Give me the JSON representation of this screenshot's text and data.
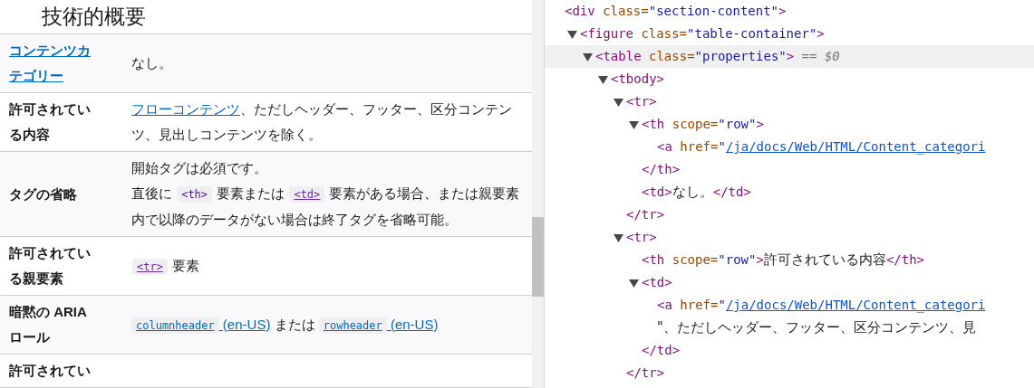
{
  "heading": "技術的概要",
  "rows": [
    {
      "header": {
        "text": "コンテンツカテゴリー",
        "link": true
      },
      "paragraphs": [
        [
          {
            "kind": "text",
            "text": "なし。"
          }
        ]
      ]
    },
    {
      "header": {
        "text": "許可されている内容",
        "link": false
      },
      "paragraphs": [
        [
          {
            "kind": "link",
            "text": "フローコンテンツ"
          },
          {
            "kind": "text",
            "text": "、ただしヘッダー、フッター、区分コンテンツ、見出しコンテンツを除く。"
          }
        ]
      ]
    },
    {
      "header": {
        "text": "タグの省略",
        "link": false
      },
      "paragraphs": [
        [
          {
            "kind": "text",
            "text": "開始タグは必須です。"
          }
        ],
        [
          {
            "kind": "text",
            "text": "直後に "
          },
          {
            "kind": "code",
            "text": "<th>"
          },
          {
            "kind": "text",
            "text": " 要素または "
          },
          {
            "kind": "visited-code-link",
            "text": "<td>"
          },
          {
            "kind": "text",
            "text": " 要素がある場合、または親要素内で以降のデータがない場合は終了タグを省略可能。"
          }
        ]
      ]
    },
    {
      "header": {
        "text": "許可されている親要素",
        "link": false
      },
      "paragraphs": [
        [
          {
            "kind": "visited-code-link",
            "text": "<tr>"
          },
          {
            "kind": "text",
            "text": " 要素"
          }
        ]
      ]
    },
    {
      "header": {
        "text": "暗黙の ARIA ロール",
        "link": false
      },
      "paragraphs": [
        [
          {
            "kind": "code-link",
            "text": "columnheader"
          },
          {
            "kind": "link",
            "text": " (en-US)"
          },
          {
            "kind": "text",
            "text": " または "
          },
          {
            "kind": "code-link",
            "text": "rowheader"
          },
          {
            "kind": "link",
            "text": " (en-US)"
          }
        ]
      ]
    },
    {
      "header": {
        "text": "許可されてい",
        "link": false
      }
    }
  ],
  "dom_tree": [
    {
      "kind": "element",
      "start": "<div",
      "attributes": [
        {
          "name": " class=",
          "value": "\"section-content\""
        }
      ],
      "end": ">",
      "children": [
        {
          "kind": "element",
          "start": "<figure",
          "attributes": [
            {
              "name": " class=",
              "value": "\"table-container\""
            }
          ],
          "end": ">",
          "expanded": true,
          "children": [
            {
              "kind": "element",
              "start": "<table",
              "attributes": [
                {
                  "name": " class=",
                  "value": "\"properties\""
                }
              ],
              "end": ">",
              "expanded": true,
              "selected": true,
              "marker": " == $0",
              "children": [
                {
                  "kind": "element",
                  "start": "<tbody",
                  "end": ">",
                  "expanded": true,
                  "children": [
                    {
                      "kind": "element",
                      "start": "<tr",
                      "end": ">",
                      "expanded": true,
                      "close": "</tr>",
                      "children": [
                        {
                          "kind": "element",
                          "start": "<th",
                          "attributes": [
                            {
                              "name": " scope=",
                              "value": "\"row\""
                            }
                          ],
                          "end": ">",
                          "expanded": true,
                          "close": "</th>",
                          "children": [
                            {
                              "kind": "element",
                              "start": "<a",
                              "attributes": [
                                {
                                  "name": " href=",
                                  "value": "\"",
                                  "link": "/ja/docs/Web/HTML/Content_categori"
                                }
                              ]
                            }
                          ]
                        },
                        {
                          "kind": "element",
                          "start": "<td",
                          "end": ">",
                          "text": "なし。",
                          "close": "</td>"
                        }
                      ]
                    },
                    {
                      "kind": "element",
                      "start": "<tr",
                      "end": ">",
                      "expanded": true,
                      "close": "</tr>",
                      "children": [
                        {
                          "kind": "element",
                          "start": "<th",
                          "attributes": [
                            {
                              "name": " scope=",
                              "value": "\"row\""
                            }
                          ],
                          "end": ">",
                          "text": "許可されている内容",
                          "close": "</th>"
                        },
                        {
                          "kind": "element",
                          "start": "<td",
                          "end": ">",
                          "expanded": true,
                          "close": "</td>",
                          "children": [
                            {
                              "kind": "element",
                              "start": "<a",
                              "attributes": [
                                {
                                  "name": " href=",
                                  "value": "\"",
                                  "link": "/ja/docs/Web/HTML/Content_categori"
                                }
                              ]
                            },
                            {
                              "kind": "text",
                              "text": "\"、ただしヘッダー、フッター、区分コンテンツ、見"
                            }
                          ]
                        }
                      ]
                    }
                  ]
                }
              ]
            }
          ]
        }
      ]
    }
  ]
}
